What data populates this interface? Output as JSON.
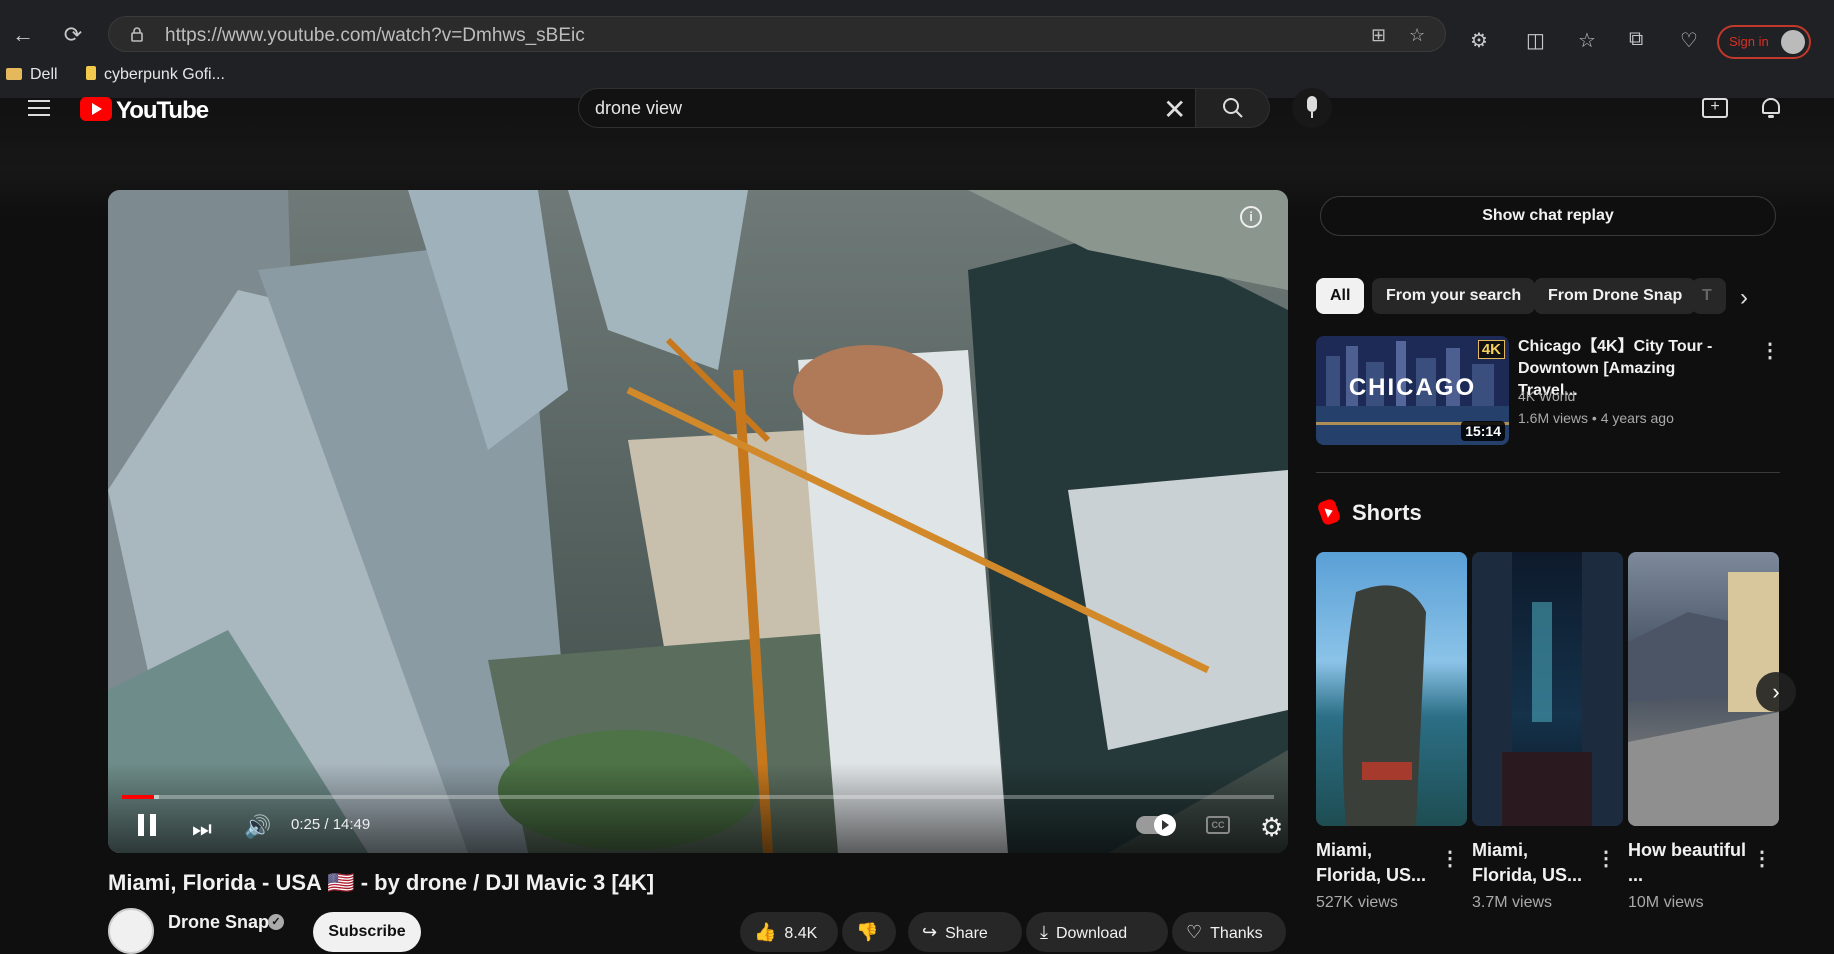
{
  "browser": {
    "url": "https://www.youtube.com/watch?v=Dmhws_sBEic",
    "signin_label": "Sign in",
    "bookmarks": [
      "Dell",
      "cyberpunk Gofi..."
    ]
  },
  "header": {
    "logo_text": "YouTube",
    "search_value": "drone view"
  },
  "player": {
    "time": "0:25 / 14:49",
    "progress_fraction": 0.028,
    "buffer_fraction": 0.032
  },
  "video": {
    "title": "Miami, Florida - USA 🇺🇸 - by drone / DJI Mavic 3 [4K]",
    "channel": "Drone Snap",
    "subscribe": "Subscribe",
    "likes": "8.4K",
    "share": "Share",
    "download": "Download",
    "thanks": "Thanks"
  },
  "sidebar": {
    "chat_replay": "Show chat replay",
    "chips": [
      "All",
      "From your search",
      "From Drone Snap",
      "T"
    ],
    "recommendation": {
      "title": "Chicago【4K】City Tour - Downtown [Amazing Travel...",
      "channel": "4K World",
      "meta": "1.6M views  • 4 years ago",
      "duration": "15:14",
      "thumb_text": "CHICAGO",
      "badge": "4K"
    },
    "shorts_heading": "Shorts",
    "shorts": [
      {
        "title": "Miami, Florida, US...",
        "views": "527K views"
      },
      {
        "title": "Miami, Florida, US...",
        "views": "3.7M views"
      },
      {
        "title": "How beautiful ...",
        "views": "10M views"
      }
    ]
  },
  "colors": {
    "accent": "#ff0000",
    "background": "#0f0f0f"
  }
}
